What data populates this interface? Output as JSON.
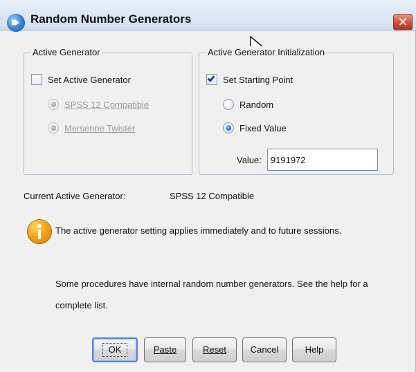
{
  "window": {
    "title": "Random Number Generators",
    "close_label": "✕"
  },
  "active_generator": {
    "group_label": "Active Generator",
    "set_label": "Set Active Generator",
    "options": [
      "SPSS 12 Compatible",
      "Mersenne Twister"
    ]
  },
  "initialization": {
    "group_label": "Active Generator Initialization",
    "set_label": "Set Starting Point",
    "random_label": "Random",
    "fixed_label": "Fixed Value",
    "value_label": "Value:",
    "value": "9191972"
  },
  "current": {
    "label": "Current Active Generator:",
    "value": "SPSS 12 Compatible"
  },
  "info": {
    "paragraph_1": "The active generator setting applies immediately and to future sessions.",
    "paragraph_2": "Some procedures have internal random number generators.  See the help for a complete list."
  },
  "buttons": {
    "ok": "OK",
    "paste": "Paste",
    "reset": "Reset",
    "cancel": "Cancel",
    "help": "Help"
  },
  "icons": {
    "window": "app-icon",
    "close": "close-icon",
    "cursor": "mouse-cursor-icon",
    "info": "info-icon"
  },
  "colors": {
    "dialog_background": "#f0f0f0",
    "title_gradient_top": "#e8f0fb",
    "title_gradient_bottom": "#d2def0",
    "close_button": "#d24c35",
    "default_button_border": "#4b87e8",
    "check_mark": "#273e96",
    "info_icon": "#f6a313"
  }
}
